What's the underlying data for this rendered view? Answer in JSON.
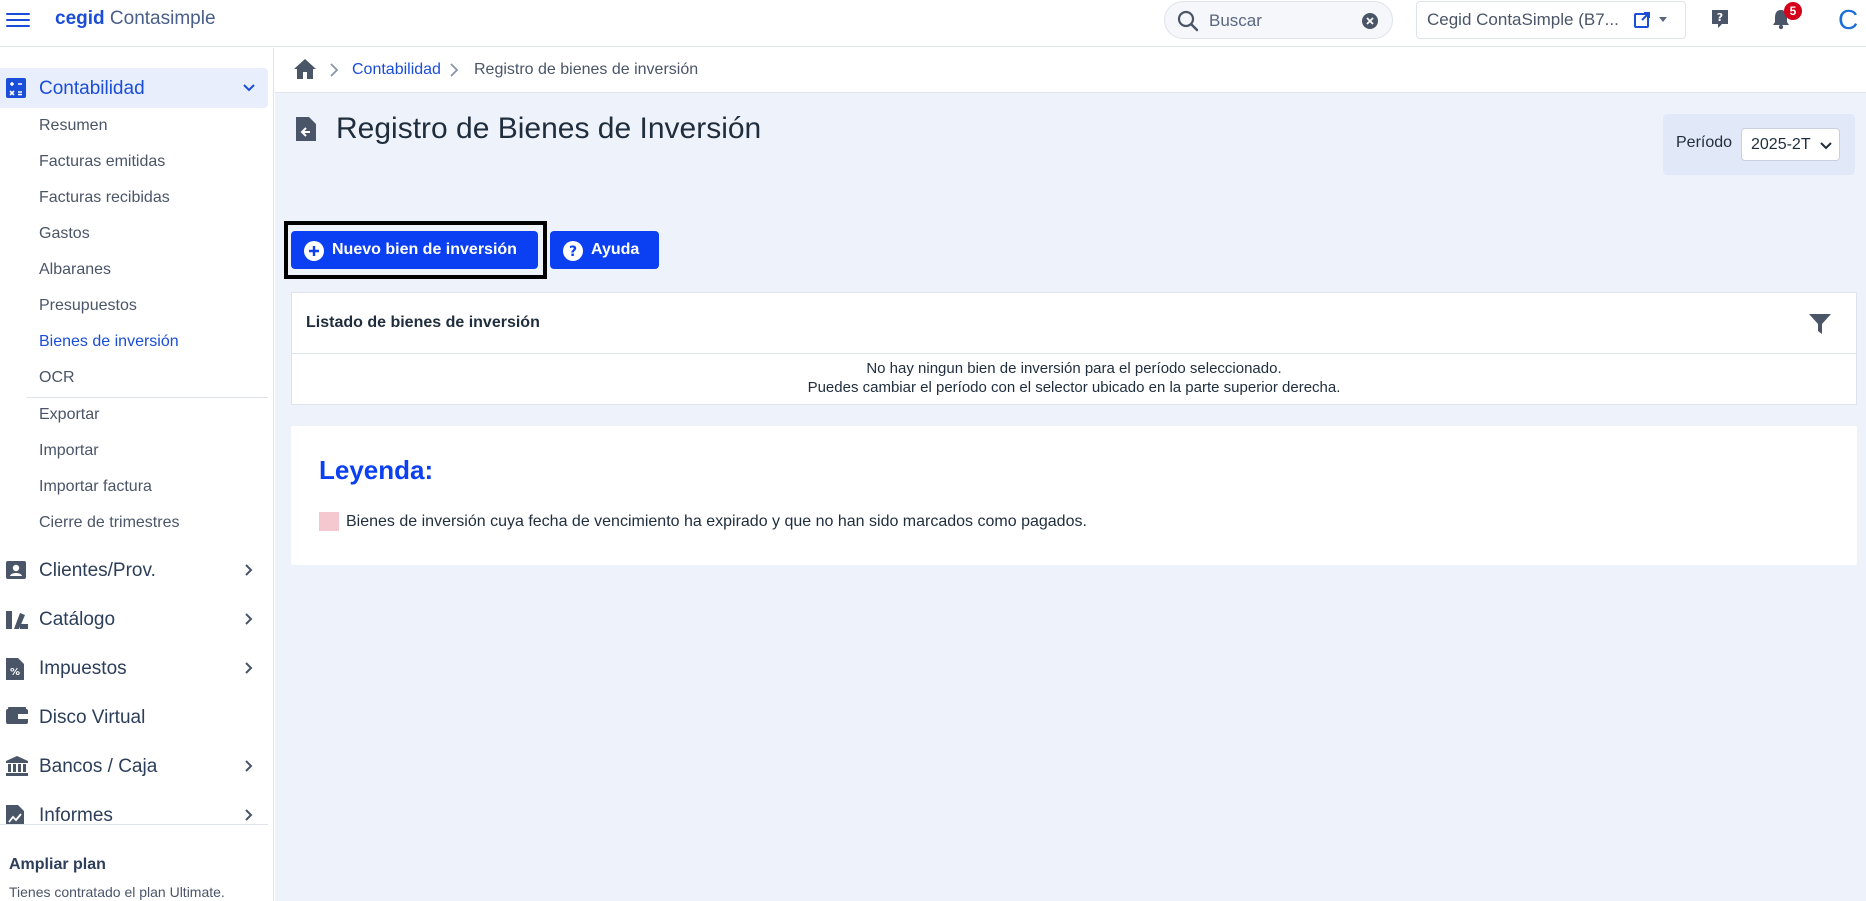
{
  "topbar": {
    "logo_bold": "cegid",
    "logo_rest": "Contasimple",
    "search_placeholder": "Buscar",
    "company_name": "Cegid ContaSimple (B7...",
    "notifications_count": "5",
    "brand_letter": "C"
  },
  "sidebar": {
    "contabilidad": {
      "label": "Contabilidad",
      "items": [
        "Resumen",
        "Facturas emitidas",
        "Facturas recibidas",
        "Gastos",
        "Albaranes",
        "Presupuestos",
        "Bienes de inversión",
        "OCR",
        "Exportar",
        "Importar",
        "Importar factura",
        "Cierre de trimestres"
      ],
      "active_item": "Bienes de inversión"
    },
    "sections": [
      {
        "label": "Clientes/Prov.",
        "icon": "contact-card-icon"
      },
      {
        "label": "Catálogo",
        "icon": "catalog-icon"
      },
      {
        "label": "Impuestos",
        "icon": "taxes-icon"
      },
      {
        "label": "Disco Virtual",
        "icon": "wallet-icon"
      },
      {
        "label": "Bancos / Caja",
        "icon": "bank-icon"
      },
      {
        "label": "Informes",
        "icon": "report-icon"
      }
    ],
    "upgrade_title": "Ampliar plan",
    "upgrade_text": "Tienes contratado el plan Ultimate."
  },
  "breadcrumb": {
    "level1": "Contabilidad",
    "level2": "Registro de bienes de inversión"
  },
  "page": {
    "title": "Registro de Bienes de Inversión",
    "period_label": "Período",
    "period_value": "2025-2T"
  },
  "actions": {
    "new_label": "Nuevo bien de inversión",
    "help_label": "Ayuda"
  },
  "list": {
    "title": "Listado de bienes de inversión",
    "empty_line1": "No hay ningun bien de inversión para el período seleccionado.",
    "empty_line2": "Puedes cambiar el período con el selector ubicado en la parte superior derecha."
  },
  "legend": {
    "title": "Leyenda:",
    "item_text": "Bienes de inversión cuya fecha de vencimiento ha expirado y que no han sido marcados como pagados.",
    "item_color": "#f5c8cf"
  },
  "colors": {
    "accent": "#1a4dd8",
    "button": "#0a3ff2",
    "badge": "#d4001a"
  }
}
